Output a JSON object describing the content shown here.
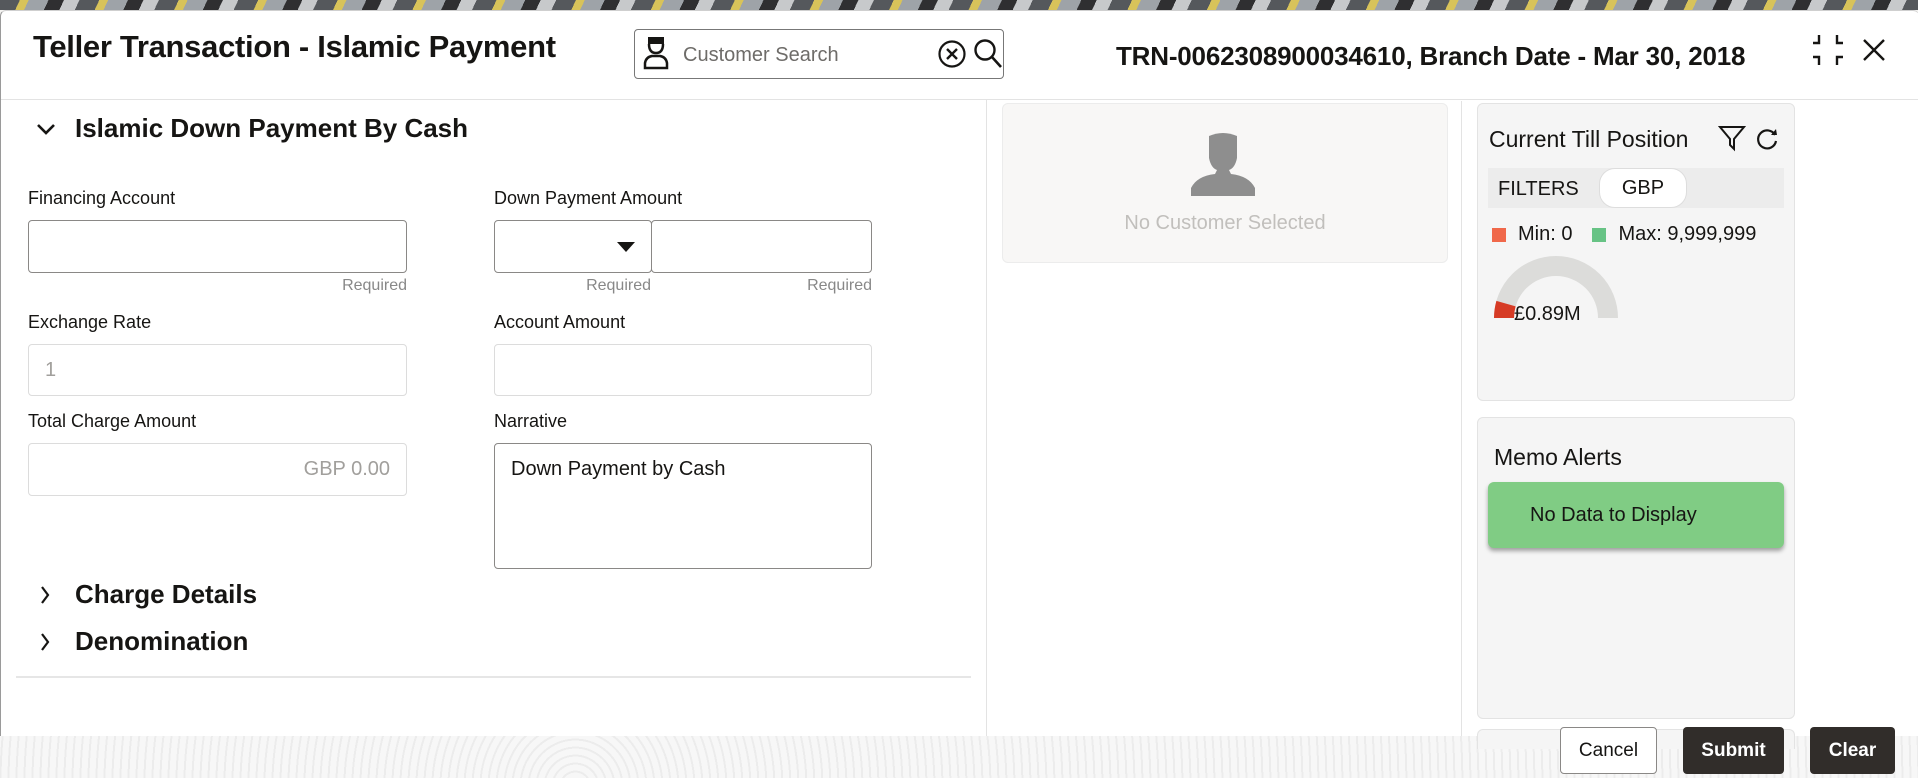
{
  "header": {
    "title": "Teller Transaction - Islamic Payment",
    "customer_search": {
      "placeholder": "Customer Search",
      "value": ""
    },
    "transaction_info": "TRN-0062308900034610, Branch Date - Mar 30, 2018"
  },
  "form": {
    "section_title": "Islamic Down Payment By Cash",
    "fields": {
      "financing_account": {
        "label": "Financing Account",
        "value": "",
        "hint": "Required"
      },
      "down_payment_amount": {
        "label": "Down Payment Amount",
        "currency": "",
        "value": "",
        "currency_hint": "Required",
        "amount_hint": "Required"
      },
      "exchange_rate": {
        "label": "Exchange Rate",
        "value": "1"
      },
      "account_amount": {
        "label": "Account Amount",
        "value": ""
      },
      "total_charge_amount": {
        "label": "Total Charge Amount",
        "value": "GBP 0.00"
      },
      "narrative": {
        "label": "Narrative",
        "value": "Down Payment by Cash"
      }
    },
    "collapsed_sections": [
      "Charge Details",
      "Denomination"
    ]
  },
  "customer_panel": {
    "message": "No Customer Selected"
  },
  "till_position": {
    "title": "Current Till Position",
    "filters_label": "FILTERS",
    "currency_filter": "GBP",
    "min_label": "Min: 0",
    "max_label": "Max: 9,999,999",
    "value_label": "£0.89M",
    "gauge": {
      "value": 890000,
      "min": 0,
      "max": 9999999
    },
    "colors": {
      "min": "#f0684a",
      "max": "#67c385",
      "fill": "#d63b25",
      "track": "#dcdcda"
    }
  },
  "memo_alerts": {
    "title": "Memo Alerts",
    "message": "No Data to Display"
  },
  "footer": {
    "cancel": "Cancel",
    "submit": "Submit",
    "clear": "Clear"
  }
}
